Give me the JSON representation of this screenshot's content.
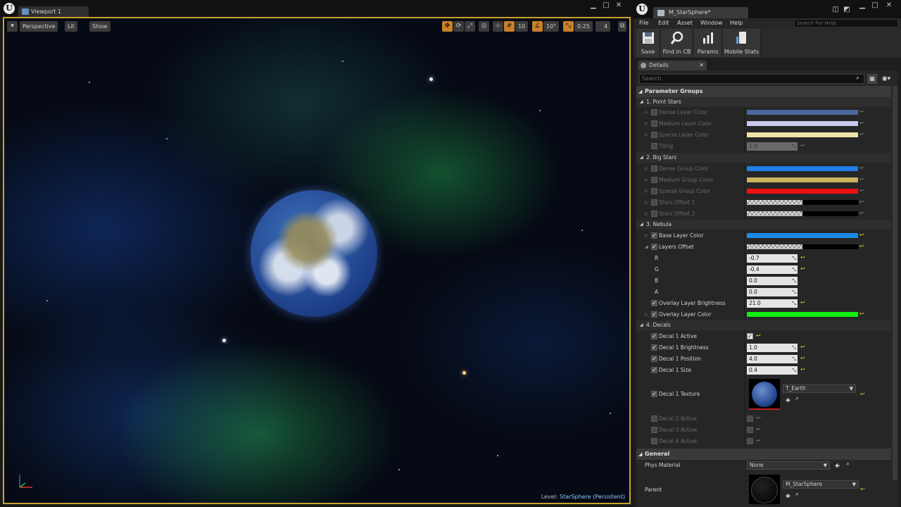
{
  "viewport": {
    "tab_label": "Viewport 1",
    "perspective_label": "Perspective",
    "lit_label": "Lit",
    "show_label": "Show",
    "grid_snap": "10",
    "rotation_snap": "10°",
    "scale_snap": "0.25",
    "camera_speed": "4",
    "level_prefix": "Level:",
    "level_name": "StarSphere (Persistent)"
  },
  "editor": {
    "asset_tab": "M_StarSphere*",
    "menu": [
      "File",
      "Edit",
      "Asset",
      "Window",
      "Help"
    ],
    "search_help_placeholder": "Search For Help",
    "toolbar": {
      "save": "Save",
      "find_in_cb": "Find in CB",
      "params": "Params",
      "mobile_stats": "Mobile Stats"
    },
    "details_tab": "Details",
    "search_placeholder": "Search"
  },
  "details": {
    "parameter_groups": "Parameter Groups",
    "point_stars": {
      "title": "1. Point Stars",
      "dense_layer_color": "Dense Layer Color",
      "medium_layer_color": "Medium Layer Color",
      "sparse_layer_color": "Sparse Layer Color",
      "tiling": "Tiling",
      "tiling_value": "1.0"
    },
    "big_stars": {
      "title": "2. Big Stars",
      "dense_group_color": "Dense Group Color",
      "medium_group_color": "Medium Group Color",
      "sparse_group_color": "Sparse Group Color",
      "stars_offset_1": "Stars Offset 1",
      "stars_offset_2": "Stars Offset 2"
    },
    "nebula": {
      "title": "3. Nebula",
      "base_layer_color": "Base Layer Color",
      "layers_offset": "Layers Offset",
      "r_label": "R",
      "r_value": "-0.7",
      "g_label": "G",
      "g_value": "-0.4",
      "b_label": "B",
      "b_value": "0.0",
      "a_label": "A",
      "a_value": "0.0",
      "overlay_brightness": "Overlay Layer Brightness",
      "overlay_brightness_value": "21.0",
      "overlay_color": "Overlay Layer Color"
    },
    "decals": {
      "title": "4. Decals",
      "decal1_active": "Decal 1 Active",
      "decal1_brightness": "Decal 1 Brightness",
      "decal1_brightness_value": "1.0",
      "decal1_position": "Decal 1 Position",
      "decal1_position_value": "4.0",
      "decal1_size": "Decal 1 Size",
      "decal1_size_value": "0.4",
      "decal1_texture": "Decal 1 Texture",
      "decal1_texture_value": "T_Earth",
      "decal2_active": "Decal 2 Active",
      "decal3_active": "Decal 3 Active",
      "decal4_active": "Decal 4 Active"
    },
    "general": {
      "title": "General",
      "phys_material": "Phys Material",
      "phys_material_value": "None",
      "parent": "Parent",
      "parent_value": "M_StarSphere"
    }
  },
  "colors": {
    "dense_layer": "#4a679e",
    "medium_layer": "#c9c9ef",
    "sparse_layer": "#ece2aa",
    "dense_group": "#1e7ee6",
    "medium_group": "#cbb25e",
    "sparse_group": "#ef0f0f",
    "base_layer": "#1a8ae6",
    "overlay_layer": "#10ef10",
    "accent": "#c8a230",
    "reset": "#e6c520"
  }
}
